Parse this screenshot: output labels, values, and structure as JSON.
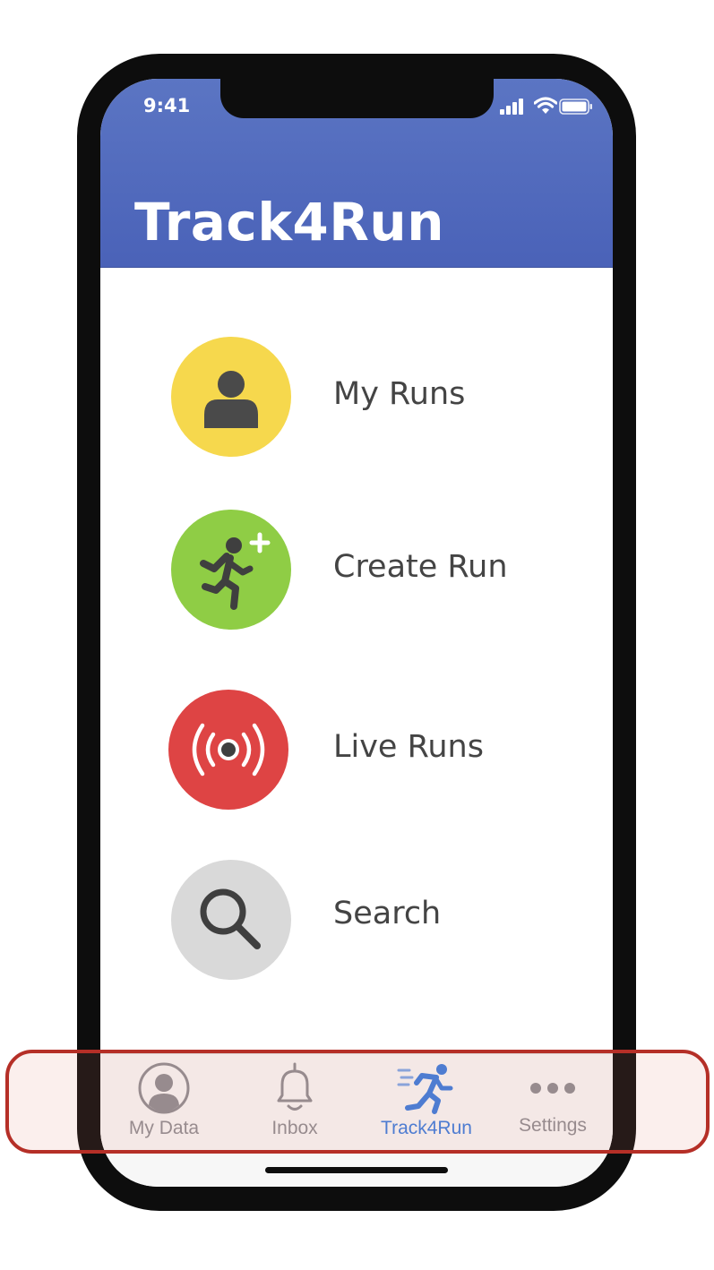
{
  "status_bar": {
    "time": "9:41"
  },
  "header": {
    "title": "Track4Run",
    "background": "#5068bb"
  },
  "menu": [
    {
      "label": "My Runs",
      "icon": "user-icon",
      "color": "#f6d84d"
    },
    {
      "label": "Create Run",
      "icon": "runner-add-icon",
      "color": "#8fcd45"
    },
    {
      "label": "Live Runs",
      "icon": "broadcast-icon",
      "color": "#de4444"
    },
    {
      "label": "Search",
      "icon": "search-icon",
      "color": "#d9d9d9"
    }
  ],
  "tabbar": {
    "tabs": [
      {
        "label": "My Data",
        "icon": "profile-icon",
        "active": false
      },
      {
        "label": "Inbox",
        "icon": "bell-icon",
        "active": false
      },
      {
        "label": "Track4Run",
        "icon": "running-icon",
        "active": true
      },
      {
        "label": "Settings",
        "icon": "more-dots-icon",
        "active": false
      }
    ],
    "active_color": "#3b7de0",
    "inactive_color": "#8e8e93",
    "highlight_color": "#b52f27"
  }
}
